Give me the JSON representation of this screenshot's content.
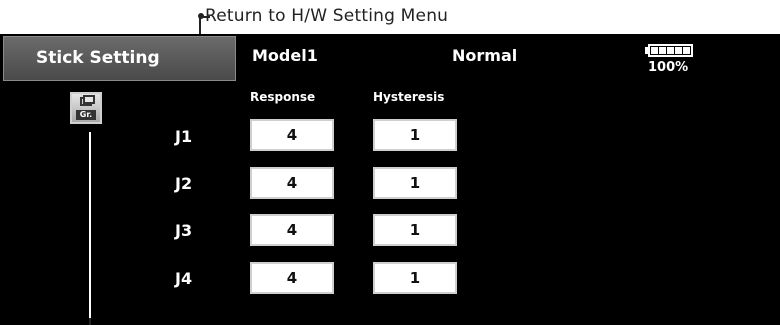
{
  "annotation": {
    "return_text": "Return to H/W Setting Menu"
  },
  "header": {
    "title": "Stick Setting",
    "model": "Model1",
    "mode": "Normal",
    "battery_percent": "100%"
  },
  "columns": {
    "response": "Response",
    "hysteresis": "Hysteresis"
  },
  "group_button": {
    "label": "Gr."
  },
  "rows": [
    {
      "label": "J1",
      "response": "4",
      "hysteresis": "1"
    },
    {
      "label": "J2",
      "response": "4",
      "hysteresis": "1"
    },
    {
      "label": "J3",
      "response": "4",
      "hysteresis": "1"
    },
    {
      "label": "J4",
      "response": "4",
      "hysteresis": "1"
    }
  ],
  "colors": {
    "screen_bg": "#000000",
    "title_bg": "#5a5a5a",
    "text": "#ffffff",
    "value_box": "#ffffff"
  },
  "icons": [
    "group-icon",
    "battery-icon"
  ]
}
